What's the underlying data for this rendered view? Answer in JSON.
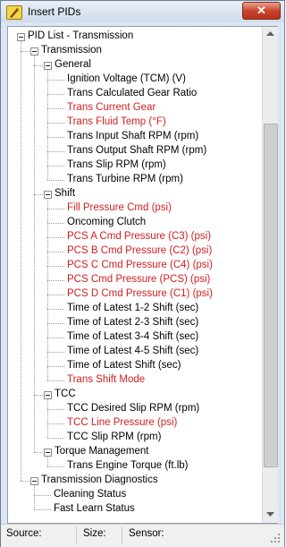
{
  "window": {
    "title": "Insert PIDs",
    "close_glyph": "✕"
  },
  "tree": [
    {
      "label": "PID List - Transmission",
      "level": 0,
      "expandable": true,
      "red": false
    },
    {
      "label": "Transmission",
      "level": 1,
      "expandable": true,
      "red": false
    },
    {
      "label": "General",
      "level": 2,
      "expandable": true,
      "red": false
    },
    {
      "label": "Ignition Voltage (TCM)   (V)",
      "level": 3,
      "expandable": false,
      "red": false
    },
    {
      "label": "Trans Calculated Gear Ratio",
      "level": 3,
      "expandable": false,
      "red": false
    },
    {
      "label": "Trans Current Gear",
      "level": 3,
      "expandable": false,
      "red": true
    },
    {
      "label": "Trans Fluid Temp   (°F)",
      "level": 3,
      "expandable": false,
      "red": true
    },
    {
      "label": "Trans Input Shaft RPM   (rpm)",
      "level": 3,
      "expandable": false,
      "red": false
    },
    {
      "label": "Trans Output Shaft RPM   (rpm)",
      "level": 3,
      "expandable": false,
      "red": false
    },
    {
      "label": "Trans Slip RPM   (rpm)",
      "level": 3,
      "expandable": false,
      "red": false
    },
    {
      "label": "Trans Turbine RPM   (rpm)",
      "level": 3,
      "expandable": false,
      "red": false
    },
    {
      "label": "Shift",
      "level": 2,
      "expandable": true,
      "red": false
    },
    {
      "label": "Fill Pressure Cmd   (psi)",
      "level": 3,
      "expandable": false,
      "red": true
    },
    {
      "label": "Oncoming Clutch",
      "level": 3,
      "expandable": false,
      "red": false
    },
    {
      "label": "PCS A Cmd Pressure (C3)   (psi)",
      "level": 3,
      "expandable": false,
      "red": true
    },
    {
      "label": "PCS B Cmd Pressure (C2)   (psi)",
      "level": 3,
      "expandable": false,
      "red": true
    },
    {
      "label": "PCS C Cmd Pressure (C4)   (psi)",
      "level": 3,
      "expandable": false,
      "red": true
    },
    {
      "label": "PCS Cmd Pressure (PCS)   (psi)",
      "level": 3,
      "expandable": false,
      "red": true
    },
    {
      "label": "PCS D Cmd Pressure (C1)   (psi)",
      "level": 3,
      "expandable": false,
      "red": true
    },
    {
      "label": "Time of Latest 1-2 Shift   (sec)",
      "level": 3,
      "expandable": false,
      "red": false
    },
    {
      "label": "Time of Latest 2-3 Shift   (sec)",
      "level": 3,
      "expandable": false,
      "red": false
    },
    {
      "label": "Time of Latest 3-4 Shift   (sec)",
      "level": 3,
      "expandable": false,
      "red": false
    },
    {
      "label": "Time of Latest 4-5 Shift   (sec)",
      "level": 3,
      "expandable": false,
      "red": false
    },
    {
      "label": "Time of Latest Shift   (sec)",
      "level": 3,
      "expandable": false,
      "red": false
    },
    {
      "label": "Trans Shift Mode",
      "level": 3,
      "expandable": false,
      "red": true
    },
    {
      "label": "TCC",
      "level": 2,
      "expandable": true,
      "red": false
    },
    {
      "label": "TCC Desired Slip RPM   (rpm)",
      "level": 3,
      "expandable": false,
      "red": false
    },
    {
      "label": "TCC Line Pressure   (psi)",
      "level": 3,
      "expandable": false,
      "red": true
    },
    {
      "label": "TCC Slip RPM   (rpm)",
      "level": 3,
      "expandable": false,
      "red": false
    },
    {
      "label": "Torque Management",
      "level": 2,
      "expandable": true,
      "red": false
    },
    {
      "label": "Trans Engine Torque   (ft.lb)",
      "level": 3,
      "expandable": false,
      "red": false
    },
    {
      "label": "Transmission Diagnostics",
      "level": 1,
      "expandable": true,
      "red": false
    },
    {
      "label": "Cleaning Status",
      "level": 2,
      "expandable": false,
      "red": false
    },
    {
      "label": "Fast Learn Status",
      "level": 2,
      "expandable": false,
      "red": false
    }
  ],
  "status": {
    "source_label": "Source:",
    "size_label": "Size:",
    "sensor_label": "Sensor:"
  },
  "colors": {
    "red_item": "#d11e1e",
    "normal_item": "#000000",
    "accent": "#dce6f2"
  }
}
